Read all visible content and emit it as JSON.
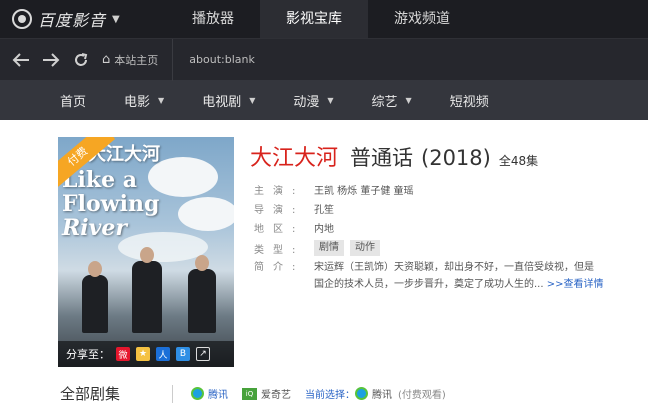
{
  "app": {
    "logo_text": "百度影音",
    "top_tabs": [
      "播放器",
      "影视宝库",
      "游戏频道"
    ],
    "active_tab": 1
  },
  "addressbar": {
    "home_label": "本站主页",
    "url": "about:blank"
  },
  "categories": [
    {
      "label": "首页",
      "has_dropdown": false
    },
    {
      "label": "电影",
      "has_dropdown": true
    },
    {
      "label": "电视剧",
      "has_dropdown": true
    },
    {
      "label": "动漫",
      "has_dropdown": true
    },
    {
      "label": "综艺",
      "has_dropdown": true
    },
    {
      "label": "短视频",
      "has_dropdown": false
    }
  ],
  "poster": {
    "badge": "付费",
    "title_cn": "大江大河",
    "title_en_1": "Like a",
    "title_en_2": "Flowing",
    "title_en_3": "River",
    "share_label": "分享至："
  },
  "show": {
    "title": "大江大河",
    "language": "普通话",
    "year": "(2018)",
    "episodes": "全48集"
  },
  "info": {
    "cast_label": "主演:",
    "cast": "王凯  杨烁  董子健  童瑶",
    "director_label": "导演:",
    "director": "孔笙",
    "region_label": "地区:",
    "region": "内地",
    "genre_label": "类型:",
    "genres": [
      "剧情",
      "动作"
    ],
    "synopsis_label": "简介:",
    "synopsis_1": "宋运辉（王凯饰）天资聪颖，却出身不好，一直倍受歧视，但是",
    "synopsis_2": "国企的技术人员，一步步晋升，奠定了成功人生的...",
    "more": ">>查看详情"
  },
  "episodes_bar": {
    "title": "全部剧集",
    "source_1": "腾讯",
    "source_2": "爱奇艺",
    "current_label": "当前选择：",
    "current_source": "腾讯",
    "paid_note": "(付费观看)"
  },
  "colors": {
    "topbar": "#1c1d22",
    "addrbar": "#26272d",
    "catbar": "#34363d",
    "title_red": "#d8231c",
    "link_blue": "#2a64c5"
  }
}
